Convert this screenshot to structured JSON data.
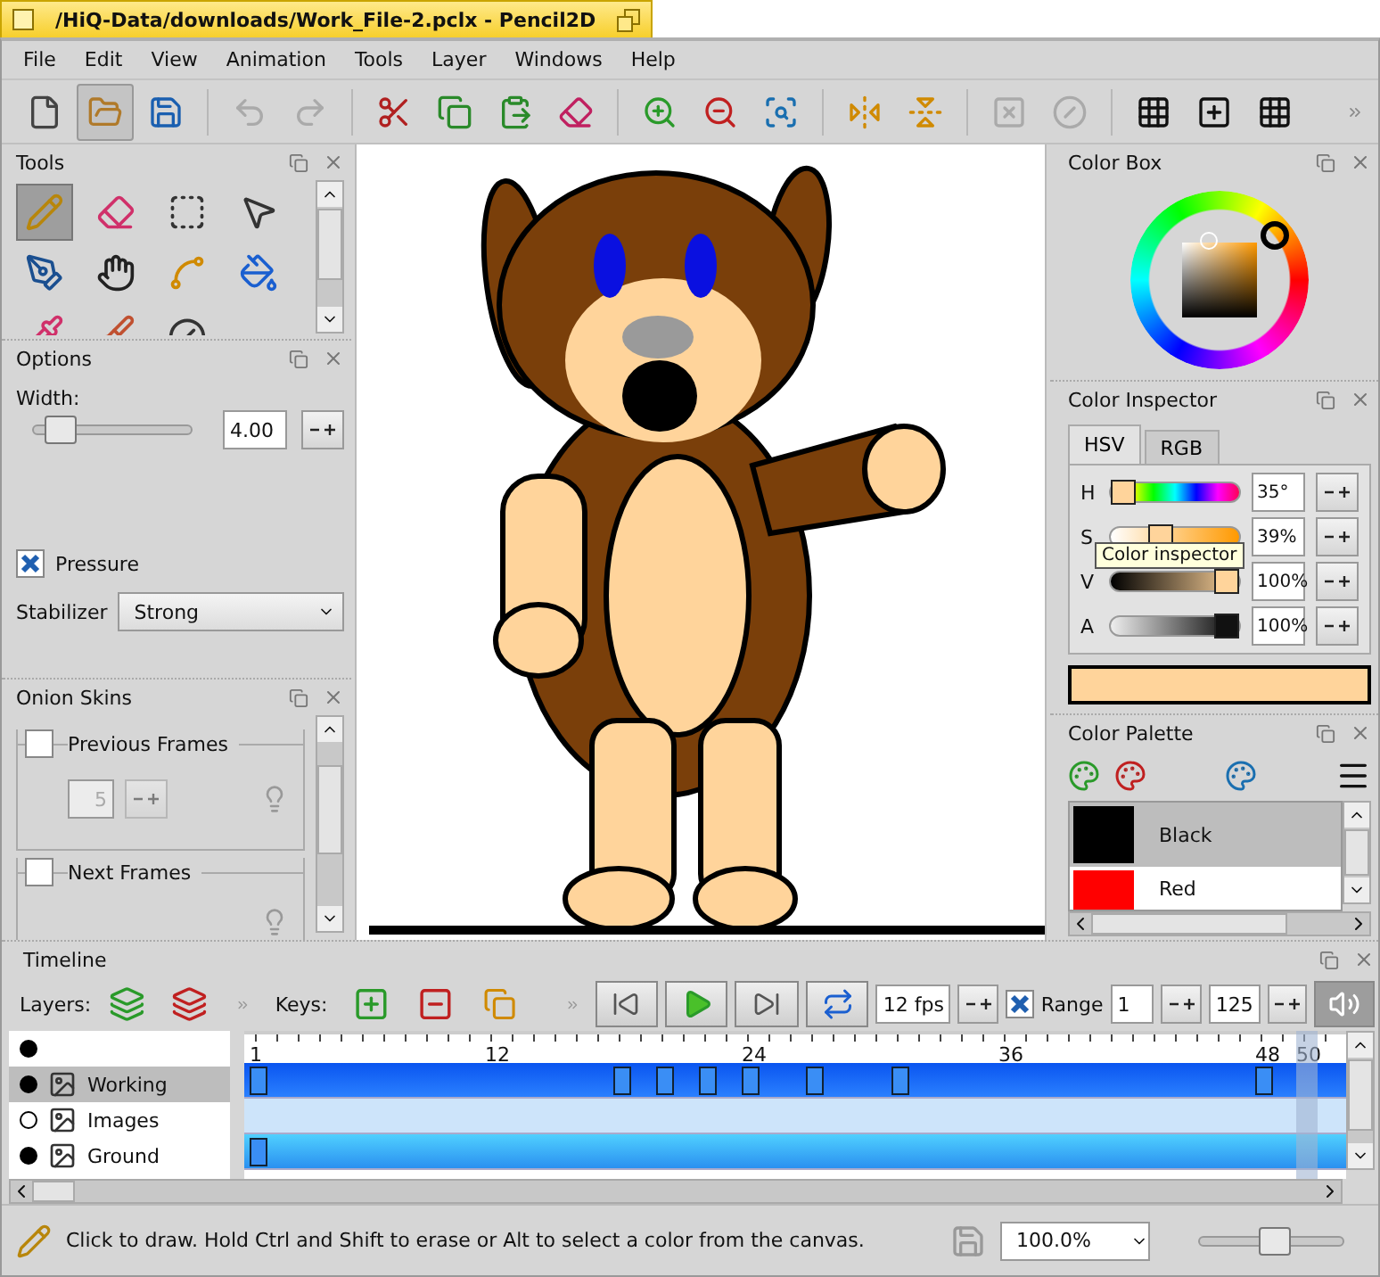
{
  "window": {
    "title": "/HiQ-Data/downloads/Work_File-2.pclx - Pencil2D"
  },
  "menu": [
    "File",
    "Edit",
    "View",
    "Animation",
    "Tools",
    "Layer",
    "Windows",
    "Help"
  ],
  "toolbar": [
    {
      "disabled": false
    },
    {
      "disabled": false
    },
    {
      "disabled": false
    },
    {
      "disabled": true
    },
    {
      "disabled": true
    },
    {
      "disabled": false
    },
    {
      "disabled": false
    },
    {
      "disabled": false
    },
    {
      "disabled": false
    },
    {
      "disabled": false
    },
    {
      "disabled": false
    },
    {
      "disabled": false
    },
    {
      "disabled": false
    },
    {
      "disabled": false
    },
    {
      "disabled": true
    },
    {
      "disabled": true
    },
    {
      "disabled": false
    },
    {
      "disabled": false
    },
    {
      "disabled": false
    }
  ],
  "tools": {
    "title": "Tools",
    "items": [
      {
        "selected": true
      },
      {
        "selected": false
      },
      {
        "selected": false
      },
      {
        "selected": false
      },
      {
        "selected": false
      },
      {
        "selected": false
      },
      {
        "selected": false
      },
      {
        "selected": false
      },
      {
        "selected": false
      },
      {
        "selected": false
      },
      {
        "selected": false
      }
    ]
  },
  "options": {
    "title": "Options",
    "width": {
      "label": "Width:",
      "level": 0.17,
      "value": "4.00"
    },
    "pressure": {
      "label": "Pressure",
      "checked": true
    },
    "stabilizer": {
      "label": "Stabilizer",
      "value": "Strong"
    }
  },
  "onion_skins": {
    "title": "Onion Skins",
    "groups": [
      {
        "label": "Previous Frames",
        "checked": false,
        "value": "5"
      },
      {
        "label": "Next Frames",
        "checked": false
      }
    ]
  },
  "color_box": {
    "title": "Color Box"
  },
  "color_inspector": {
    "title": "Color Inspector",
    "tabs": [
      {
        "label": "HSV",
        "selected": true
      },
      {
        "label": "RGB",
        "selected": false
      }
    ],
    "channels": [
      {
        "name": "H",
        "level": 0.1,
        "value": "35°"
      },
      {
        "name": "S",
        "level": 0.39,
        "value": "39%"
      },
      {
        "name": "V",
        "level": 1,
        "value": "100%"
      },
      {
        "name": "A",
        "level": 1,
        "value": "100%"
      }
    ],
    "color": "#ffd49b",
    "tooltip": "Color inspector"
  },
  "color_palette": {
    "title": "Color Palette",
    "colors": [
      {
        "name": "Black",
        "color": "#000000",
        "selected": true
      },
      {
        "name": "Red",
        "color": "#ff0000",
        "selected": false
      }
    ]
  },
  "timeline": {
    "title": "Timeline",
    "layers_label": "Layers:",
    "keys_label": "Keys:",
    "fps": "12 fps",
    "range": {
      "label": "Range",
      "checked": true,
      "start": "1",
      "end": "125"
    },
    "sound": {
      "selected": true
    },
    "ruler": [
      "1",
      "12",
      "24",
      "36",
      "48"
    ],
    "current_frame": "50",
    "all_layers": {
      "visible": true
    },
    "layers": [
      {
        "name": "Working",
        "visible": true,
        "selected": true,
        "keys": [
          true,
          false,
          false,
          false,
          false,
          false,
          false,
          false,
          false,
          false,
          false,
          false,
          false,
          false,
          false,
          false,
          false,
          true,
          false,
          true,
          false,
          true,
          false,
          true,
          false,
          false,
          true,
          false,
          false,
          false,
          true,
          false,
          false,
          false,
          false,
          false,
          false,
          false,
          false,
          false,
          false,
          false,
          false,
          false,
          false,
          false,
          false,
          true,
          false,
          false
        ]
      },
      {
        "name": "Images",
        "visible": false,
        "selected": false
      },
      {
        "name": "Ground",
        "visible": true,
        "selected": false,
        "keys": [
          true,
          false,
          false,
          false,
          false,
          false,
          false,
          false,
          false,
          false,
          false,
          false,
          false,
          false,
          false,
          false,
          false,
          false,
          false,
          false,
          false,
          false,
          false,
          false,
          false,
          false,
          false,
          false,
          false,
          false,
          false,
          false,
          false,
          false,
          false,
          false,
          false,
          false,
          false,
          false,
          false,
          false,
          false,
          false,
          false,
          false,
          false,
          false,
          false,
          false
        ]
      }
    ]
  },
  "status": {
    "message": "Click to draw. Hold Ctrl and Shift to erase or Alt to select a color from the canvas.",
    "zoom": "100.0%",
    "zoom_slider": {
      "level": 0.52
    }
  }
}
